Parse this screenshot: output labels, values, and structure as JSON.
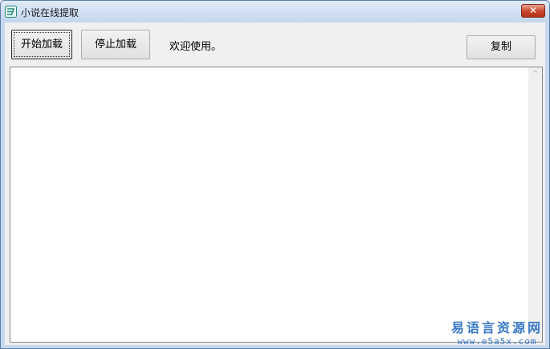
{
  "window": {
    "title": "小说在线提取",
    "close_glyph": "✕"
  },
  "toolbar": {
    "start_label": "开始加载",
    "stop_label": "停止加载",
    "status_text": "欢迎使用。",
    "copy_label": "复制"
  },
  "content": {
    "text": ""
  },
  "watermark": {
    "line1": "易语言资源网",
    "line2": "www.e5a5x.com"
  },
  "icons": {
    "app_icon": "app-icon",
    "close": "close-icon",
    "scroll_up": "scroll-up-arrow-icon"
  },
  "colors": {
    "title_bar": "#c3d6ee",
    "close_button": "#c6452c",
    "watermark": "#3a79c6"
  }
}
